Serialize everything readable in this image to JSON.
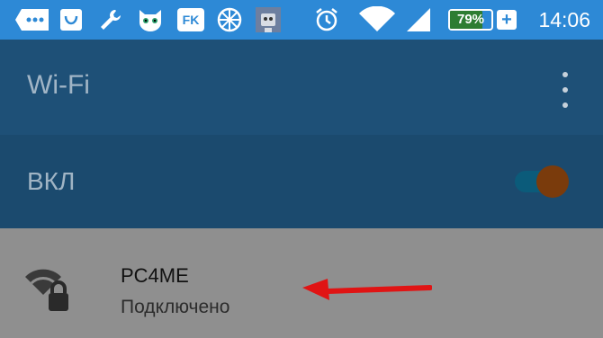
{
  "status_bar": {
    "time": "14:06",
    "battery_text": "79%",
    "battery_level": 79,
    "battery_plus": "+",
    "icons": [
      "more-icon",
      "shopping-bag-icon",
      "wrench-icon",
      "cat-app-icon",
      "fk-app-icon",
      "globe-app-icon",
      "robot-app-icon",
      "alarm-icon",
      "wifi-signal-icon",
      "cell-signal-icon"
    ],
    "fk_label": "FK"
  },
  "toolbar": {
    "title": "Wi-Fi",
    "menu_icon": "more-vert-icon"
  },
  "switch_row": {
    "label": "ВКЛ",
    "state": "on"
  },
  "network": {
    "name": "PC4ME",
    "status": "Подключено",
    "icon": "wifi-lock-icon"
  },
  "colors": {
    "status_bar_bg": "#2d89d6",
    "toolbar_bg": "#1e5077",
    "switch_row_bg": "#1b4a6e",
    "list_bg": "#8f8f8f",
    "switch_thumb": "#7a3b0c",
    "arrow": "#e01414"
  }
}
